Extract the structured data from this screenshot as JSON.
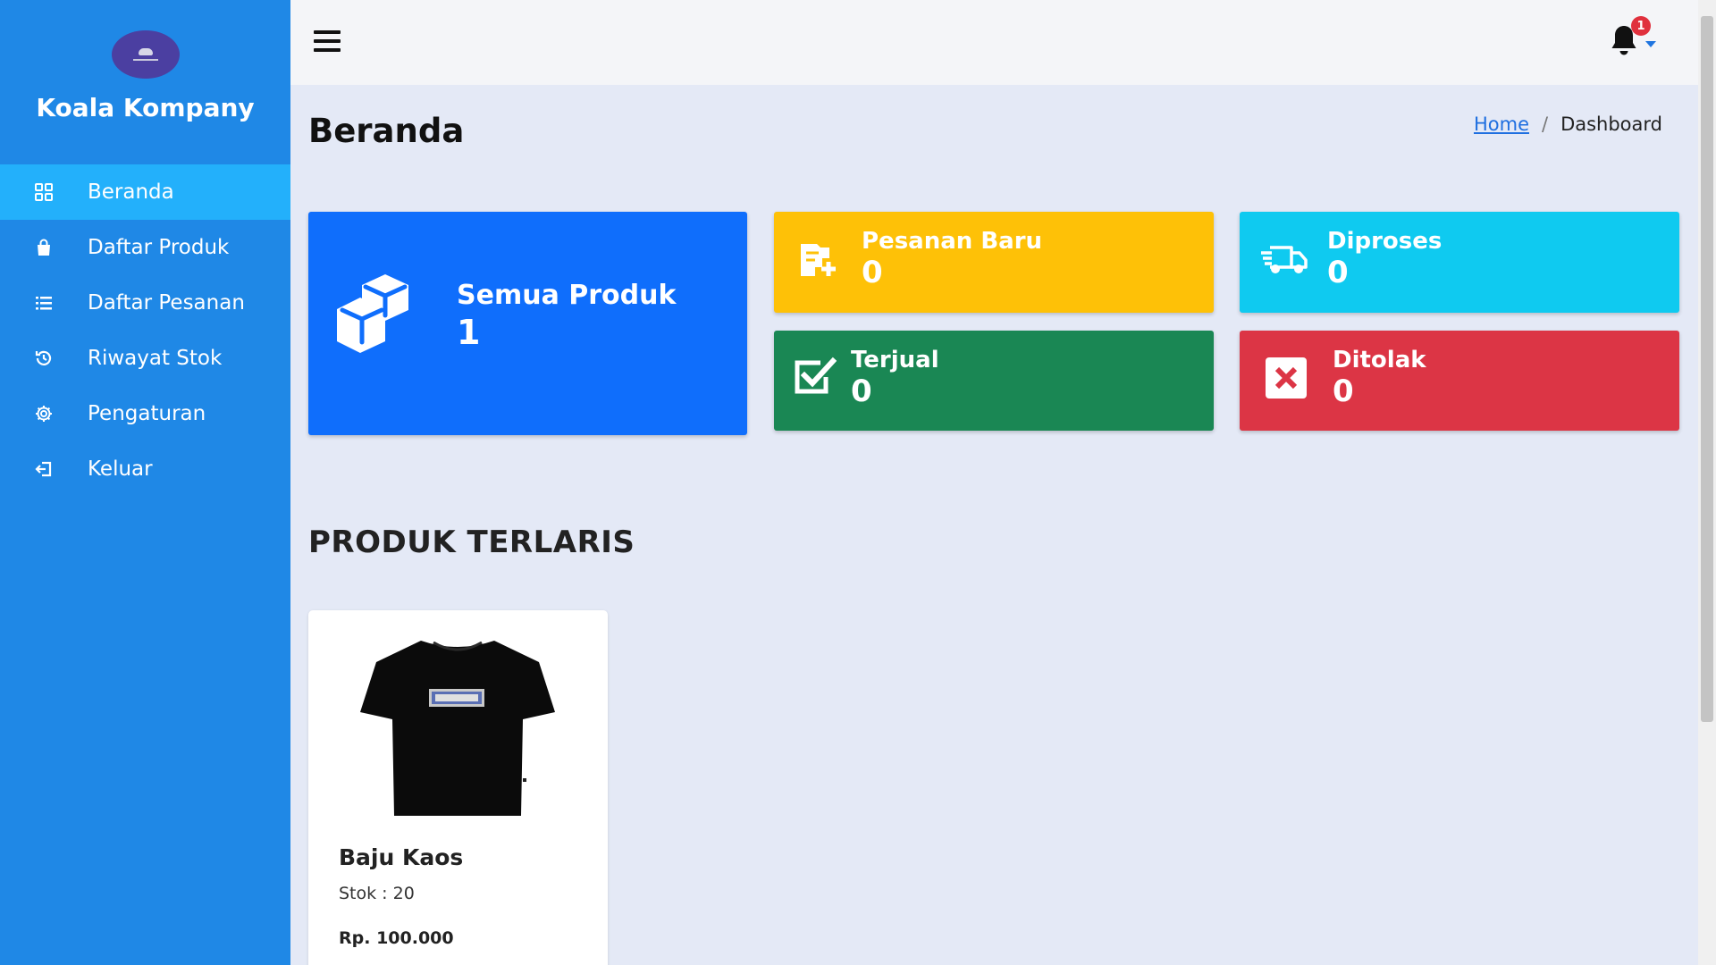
{
  "brand": {
    "name": "Koala Kompany",
    "logo_icon": "koala-logo-icon"
  },
  "sidebar": {
    "items": [
      {
        "label": "Beranda",
        "icon": "grid-icon",
        "active": true
      },
      {
        "label": "Daftar Produk",
        "icon": "bag-icon"
      },
      {
        "label": "Daftar Pesanan",
        "icon": "list-icon"
      },
      {
        "label": "Riwayat Stok",
        "icon": "history-icon"
      },
      {
        "label": "Pengaturan",
        "icon": "gear-icon"
      },
      {
        "label": "Keluar",
        "icon": "logout-icon"
      }
    ]
  },
  "topbar": {
    "menu_icon": "hamburger-icon",
    "notifications": {
      "icon": "bell-icon",
      "count": "1"
    }
  },
  "page": {
    "title": "Beranda",
    "breadcrumb": {
      "home": "Home",
      "current": "Dashboard",
      "separator": "/"
    }
  },
  "stats": {
    "all_products": {
      "label": "Semua Produk",
      "value": "1",
      "icon": "boxes-icon",
      "color": "#0f6efc"
    },
    "new_orders": {
      "label": "Pesanan Baru",
      "value": "0",
      "icon": "cart-plus-icon",
      "color": "#fec107"
    },
    "processed": {
      "label": "Diproses",
      "value": "0",
      "icon": "truck-icon",
      "color": "#0fcaf0"
    },
    "sold": {
      "label": "Terjual",
      "value": "0",
      "icon": "check-square-icon",
      "color": "#1a8754"
    },
    "rejected": {
      "label": "Ditolak",
      "value": "0",
      "icon": "x-square-icon",
      "color": "#dc3545"
    }
  },
  "bestsellers": {
    "title": "PRODUK TERLARIS",
    "products": [
      {
        "name": "Baju Kaos",
        "stock": "Stok : 20",
        "price": "Rp. 100.000",
        "image_icon": "tshirt-image"
      }
    ]
  },
  "colors": {
    "sidebar": "#1f88e6",
    "active_item": "#23b0fb",
    "background": "#e4e9f6"
  }
}
